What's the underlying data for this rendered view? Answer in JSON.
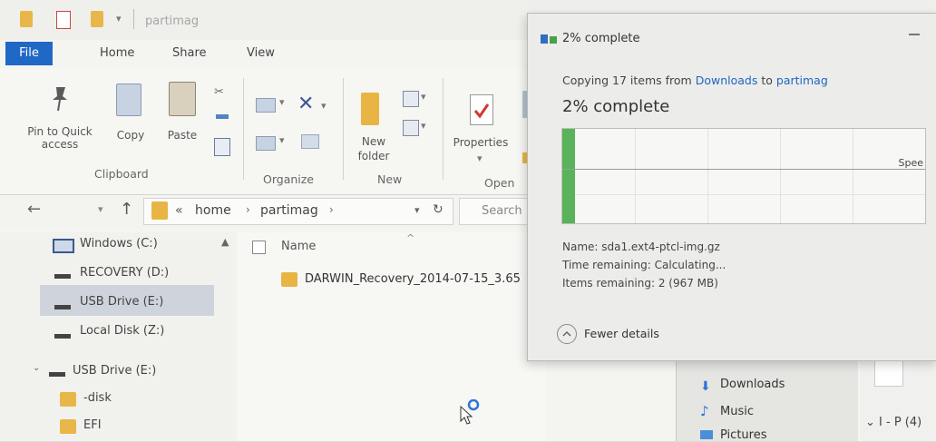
{
  "explorer": {
    "window_title": "partimag",
    "tabs": [
      "File",
      "Home",
      "Share",
      "View"
    ],
    "ribbon": {
      "pin": "Pin to Quick access",
      "copy": "Copy",
      "paste": "Paste",
      "new_folder": "New folder",
      "properties": "Properties",
      "groups": {
        "clipboard": "Clipboard",
        "organize": "Organize",
        "new": "New",
        "open": "Open"
      }
    },
    "address": {
      "crumb_prefix": "«",
      "crumbs": [
        "home",
        "partimag"
      ],
      "search_placeholder": "Search"
    },
    "nav_items": [
      "Windows (C:)",
      "RECOVERY (D:)",
      "USB Drive (E:)",
      "Local Disk (Z:)",
      "USB Drive (E:)",
      "-disk",
      "EFI"
    ],
    "column_name": "Name",
    "files": [
      "DARWIN_Recovery_2014-07-15_3.65"
    ]
  },
  "dialog": {
    "title": "2% complete",
    "copy_prefix": "Copying 17 items from",
    "source": "Downloads",
    "to_word": "to",
    "destination": "partimag",
    "status": "2% complete",
    "progress_fraction": 0.02,
    "speed_label": "Spee",
    "name_line": "Name: sda1.ext4-ptcl-img.gz",
    "time_line": "Time remaining:  Calculating...",
    "items_line": "Items remaining:  2 (967 MB)",
    "fewer_details": "Fewer details"
  },
  "background_pane": {
    "items": [
      "Downloads",
      "Music",
      "Pictures"
    ],
    "right_text": "I - P (4)"
  }
}
